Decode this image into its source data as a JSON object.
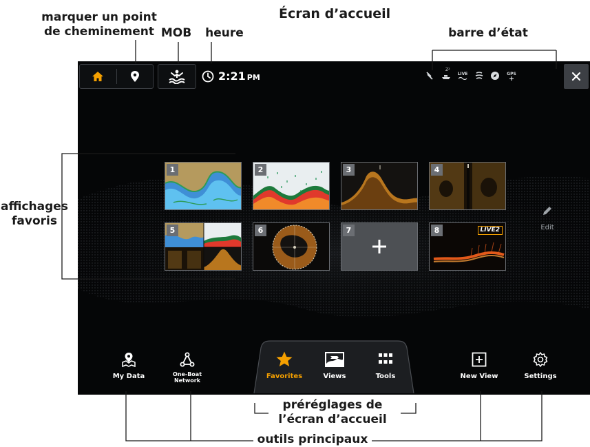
{
  "annotations": {
    "title": "Écran d’accueil",
    "waypoint_line1": "marquer un point",
    "waypoint_line2": "de cheminement",
    "mob": "MOB",
    "time": "heure",
    "status_bar": "barre d’état",
    "favorites_line1": "affichages",
    "favorites_line2": "favoris",
    "presets_line1": "préréglages de",
    "presets_line2": "l’écran d’accueil",
    "main_tools": "outils principaux"
  },
  "screen": {
    "clock": {
      "time": "2:21",
      "ampm": "PM"
    },
    "status_icons": [
      "antenna-icon",
      "boat-icon",
      "live-icon",
      "sonar-icon",
      "compass-icon",
      "gps-icon"
    ],
    "status_text": {
      "zzz": "Z²",
      "live": "LIVE",
      "gps": "GPS"
    },
    "favorites": [
      {
        "number": "1",
        "view": "chart"
      },
      {
        "number": "2",
        "view": "sonar"
      },
      {
        "number": "3",
        "view": "down-imaging"
      },
      {
        "number": "4",
        "view": "side-imaging"
      },
      {
        "number": "5",
        "view": "combo"
      },
      {
        "number": "6",
        "view": "360-imaging"
      },
      {
        "number": "7",
        "view": "add"
      },
      {
        "number": "8",
        "view": "live",
        "badge": "LIVE2"
      }
    ],
    "edit_label": "Edit",
    "tools": {
      "my_data": "My Data",
      "network": "One-Boat Network",
      "new_view": "New View",
      "settings": "Settings"
    },
    "presets": {
      "favorites": "Favorites",
      "views": "Views",
      "tools": "Tools"
    }
  },
  "colors": {
    "accent": "#f5a000",
    "screen_bg": "#050607",
    "tile_number_bg": "#6b6e73"
  }
}
